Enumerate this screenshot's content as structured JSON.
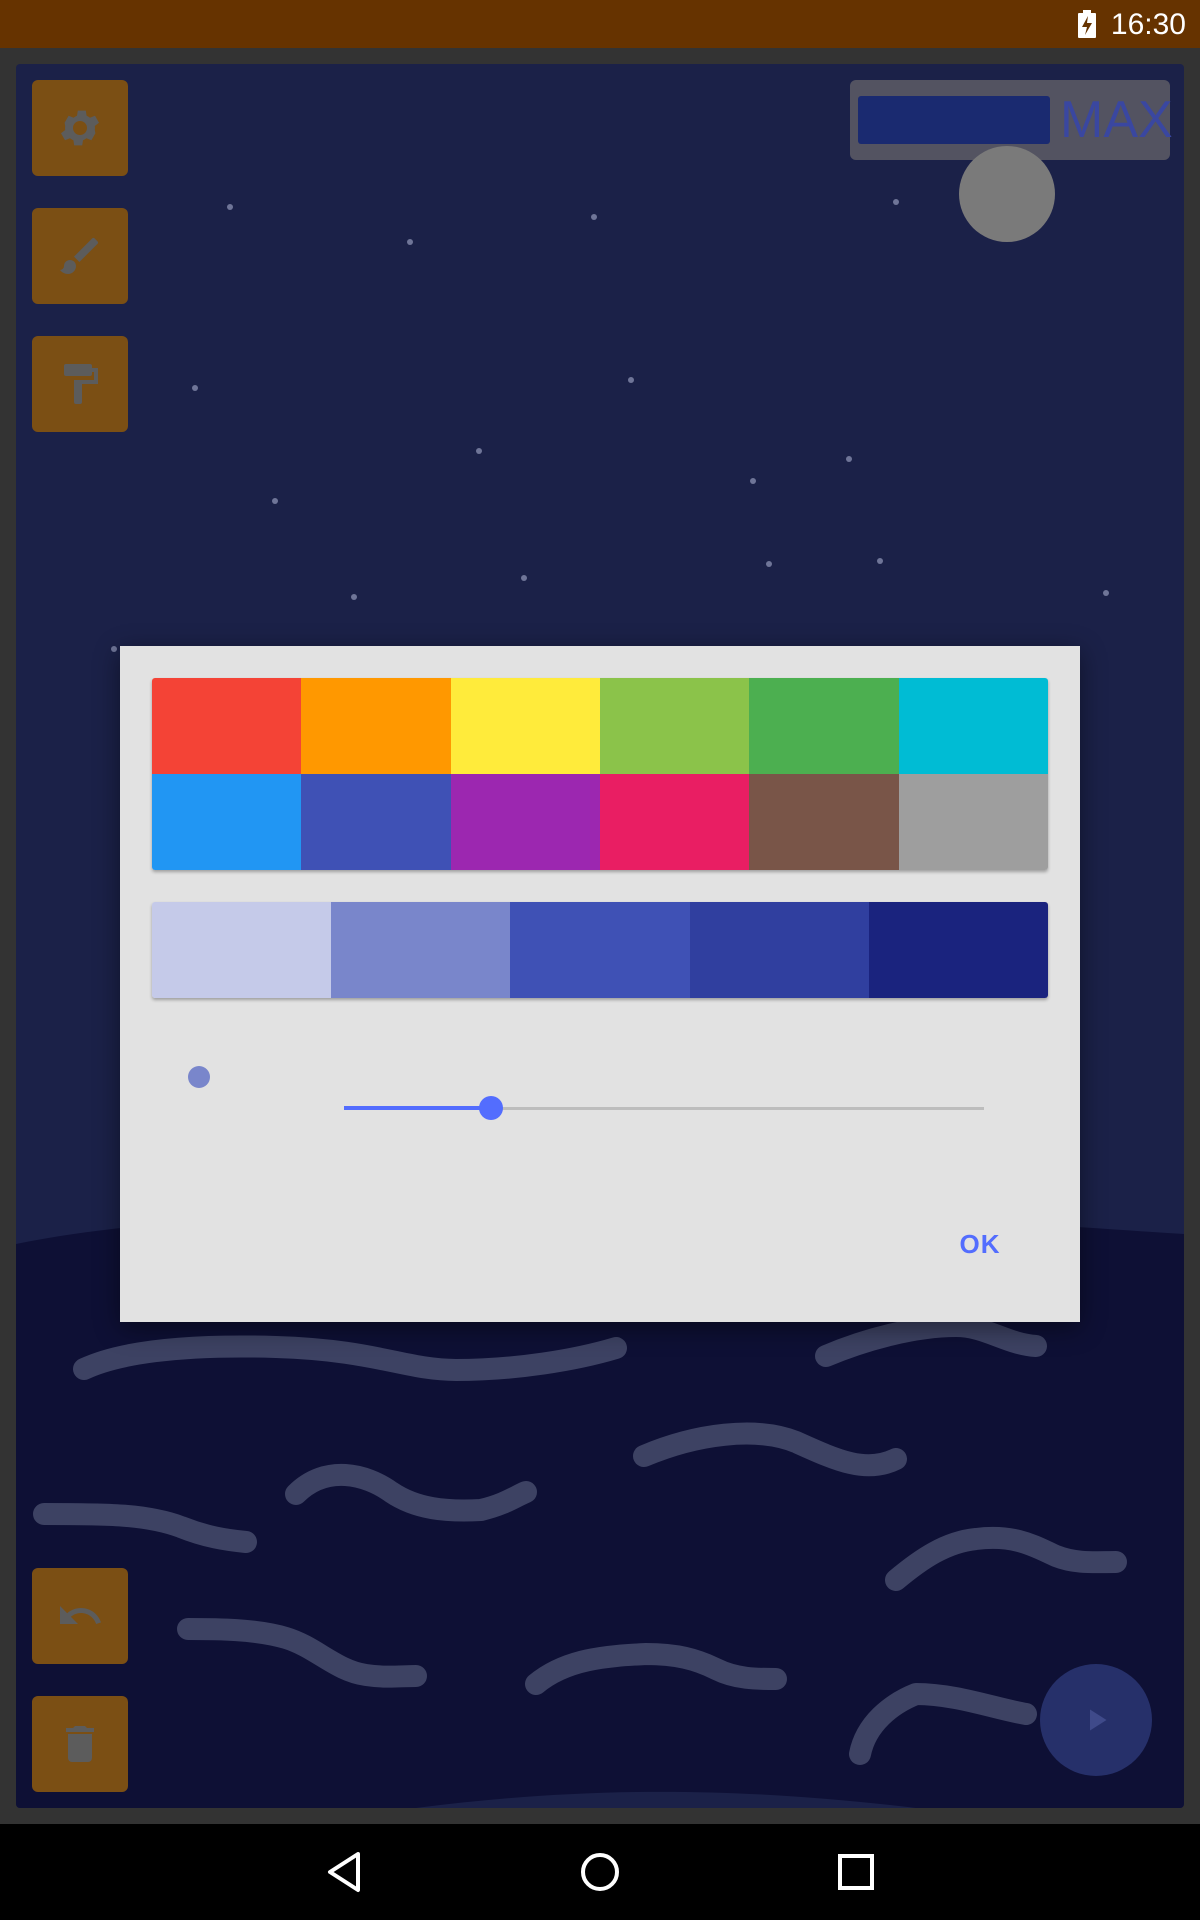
{
  "status_bar": {
    "time": "16:30",
    "battery_icon": "battery-charging-icon",
    "background": "#663300"
  },
  "toolbar": {
    "buttons": [
      {
        "name": "settings",
        "icon": "gear-icon"
      },
      {
        "name": "brush",
        "icon": "brush-icon"
      },
      {
        "name": "fill",
        "icon": "paint-roller-icon"
      }
    ],
    "bottom_buttons": [
      {
        "name": "undo",
        "icon": "undo-icon"
      },
      {
        "name": "delete",
        "icon": "trash-icon"
      }
    ],
    "button_color": "#7b4f14"
  },
  "size_indicator": {
    "label": "MAX"
  },
  "play_button": {
    "icon": "play-icon"
  },
  "color_dialog": {
    "palette": [
      "#f44336",
      "#ff9800",
      "#ffeb3b",
      "#8bc34a",
      "#4caf50",
      "#00bcd4",
      "#2196f3",
      "#3f51b5",
      "#9c27b0",
      "#e91e63",
      "#795548",
      "#9e9e9e"
    ],
    "shades": [
      "#c5cae9",
      "#7986cb",
      "#3f51b5",
      "#303f9f",
      "#1a237e"
    ],
    "brush_preview_color": "#7986cb",
    "slider_value": 0.23,
    "ok_label": "OK",
    "accent": "#536dfe"
  },
  "nav_bar": {
    "back_icon": "back-triangle-icon",
    "home_icon": "home-circle-icon",
    "recents_icon": "recents-square-icon"
  }
}
